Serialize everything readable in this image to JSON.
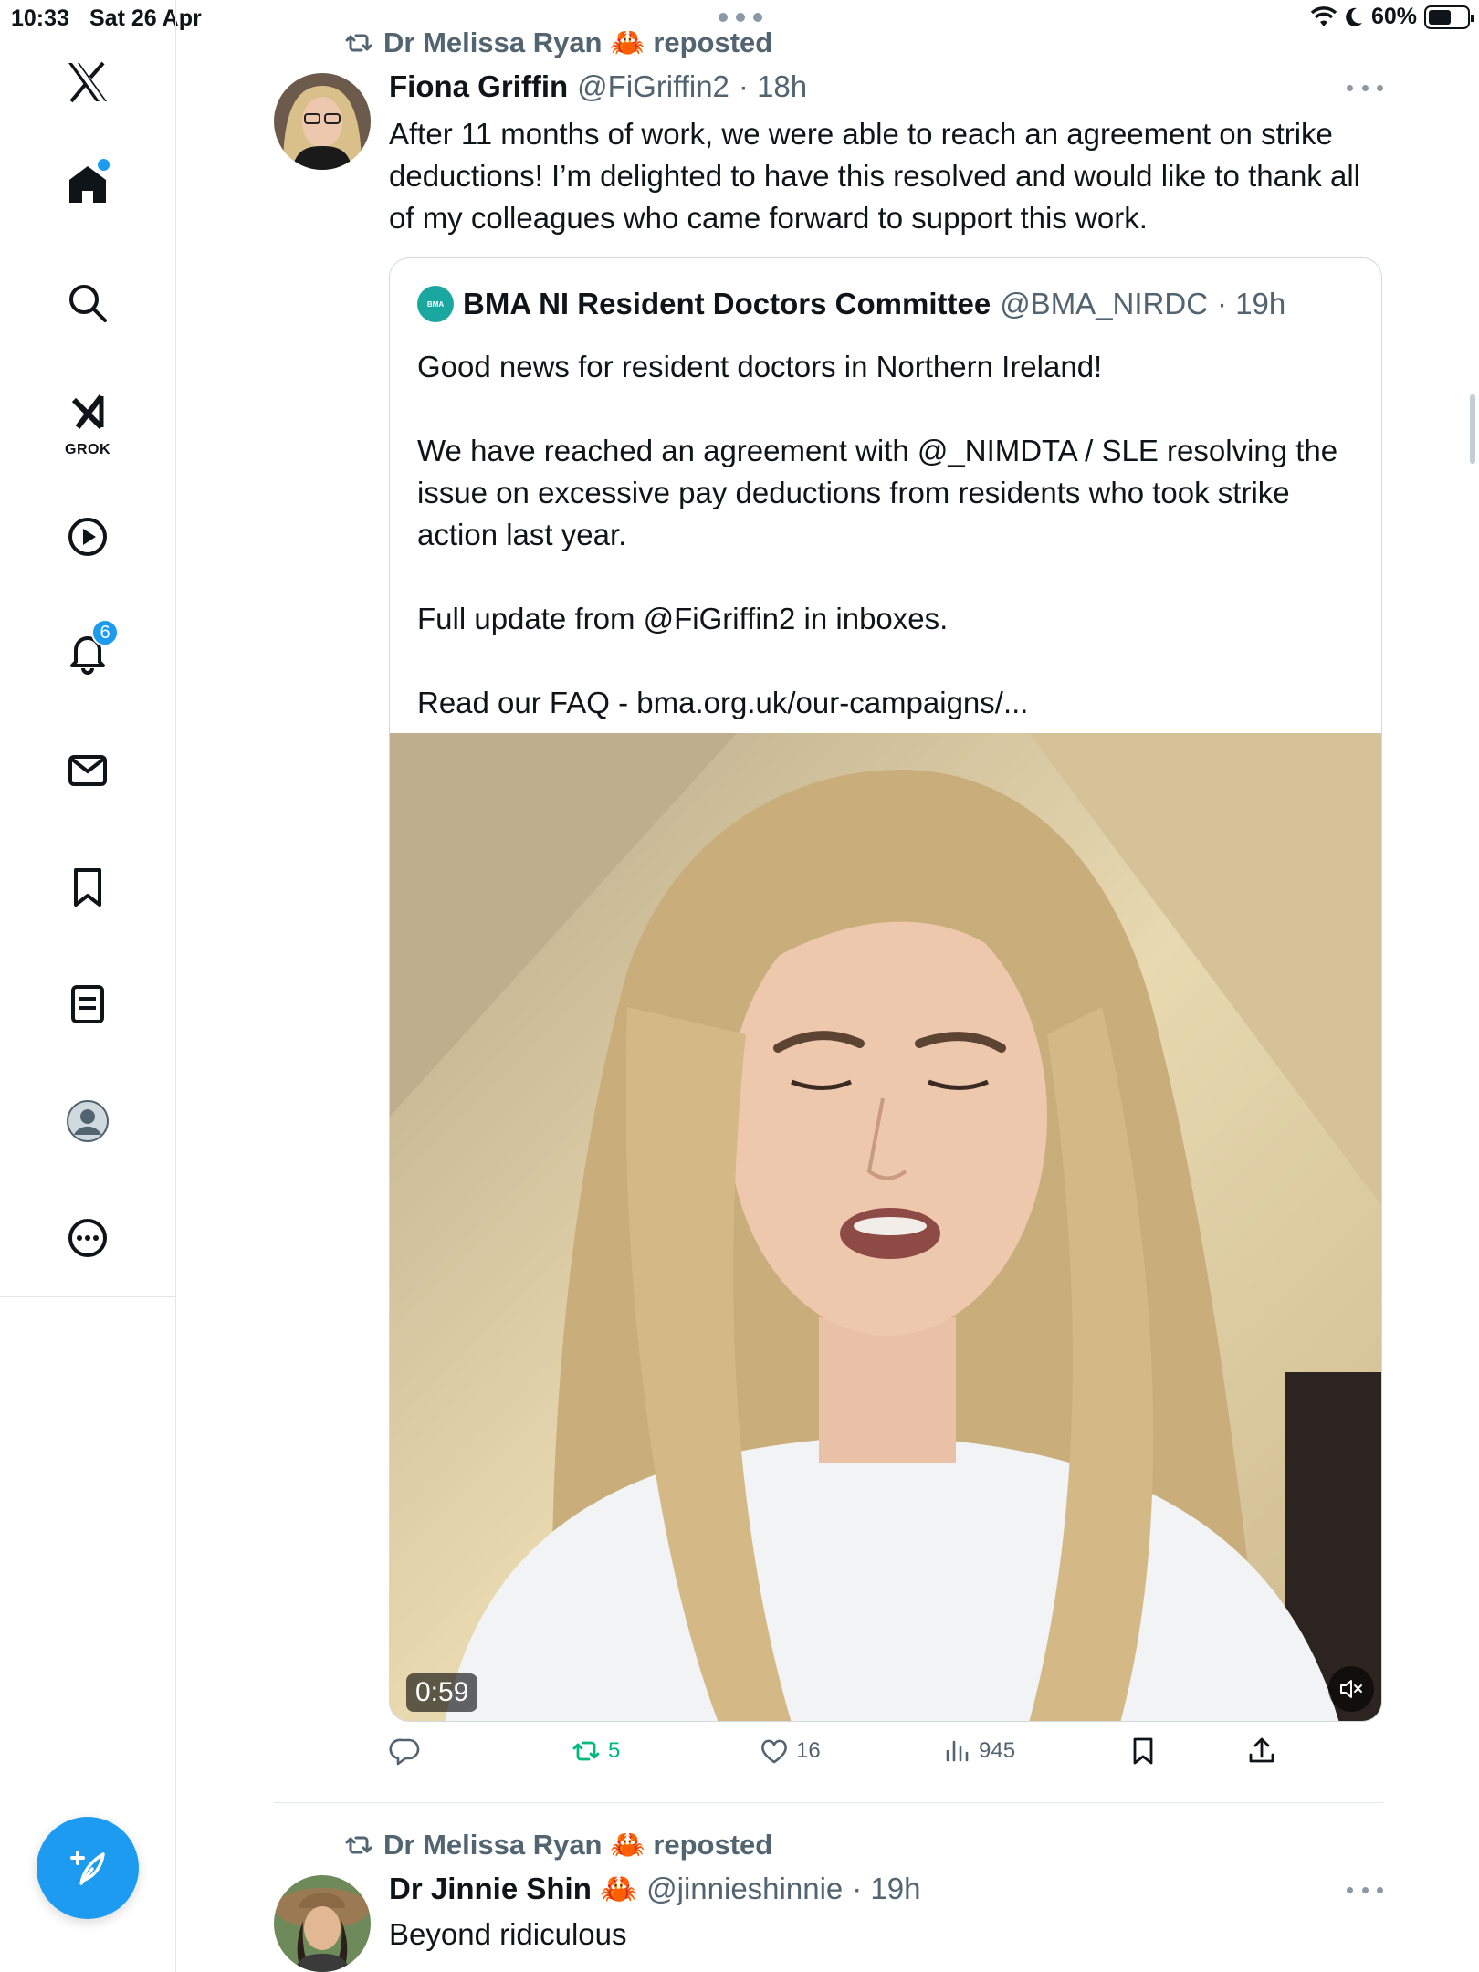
{
  "status_bar": {
    "time": "10:33",
    "date": "Sat 26 Apr",
    "battery": "60%"
  },
  "sidebar": {
    "items": [
      {
        "name": "x-logo-icon"
      },
      {
        "name": "home-icon",
        "has_dot": true
      },
      {
        "name": "search-icon"
      },
      {
        "name": "grok-icon",
        "label": "GROK"
      },
      {
        "name": "video-icon"
      },
      {
        "name": "notifications-icon",
        "badge": "6"
      },
      {
        "name": "messages-icon"
      },
      {
        "name": "bookmarks-icon"
      },
      {
        "name": "lists-icon"
      },
      {
        "name": "profile-icon"
      },
      {
        "name": "more-icon"
      }
    ],
    "compose_icon": "compose-icon",
    "accent": "#1d9bf0"
  },
  "feed": {
    "tweets": [
      {
        "repost_by": "Dr Melissa Ryan 🦀 reposted",
        "display_name": "Fiona Griffin",
        "handle": "@FiGriffin2",
        "time": "· 18h",
        "text": "After 11 months of work, we were able to reach an agreement on strike deductions! I’m delighted to have this resolved and would like to thank all of my colleagues who came forward to support this work.",
        "quote": {
          "logo_text": "BMA",
          "display_name": "BMA NI Resident Doctors Committee",
          "handle": "@BMA_NIRDC",
          "time": "· 19h",
          "paragraphs": [
            "Good news for resident doctors in Northern Ireland!",
            "We have reached an agreement with @_NIMDTA / SLE resolving the issue on excessive pay deductions from residents who took strike action last year.",
            "Full update from @FiGriffin2 in inboxes.",
            "Read our FAQ - bma.org.uk/our-campaigns/..."
          ],
          "video": {
            "duration": "0:59",
            "muted": true
          }
        },
        "actions": {
          "replies": "",
          "reposts": "5",
          "likes": "16",
          "views": "945"
        }
      },
      {
        "repost_by": "Dr Melissa Ryan 🦀 reposted",
        "display_name": "Dr Jinnie Shin 🦀",
        "handle": "@jinnieshinnie",
        "time": "· 19h",
        "text": "Beyond ridiculous"
      }
    ]
  }
}
